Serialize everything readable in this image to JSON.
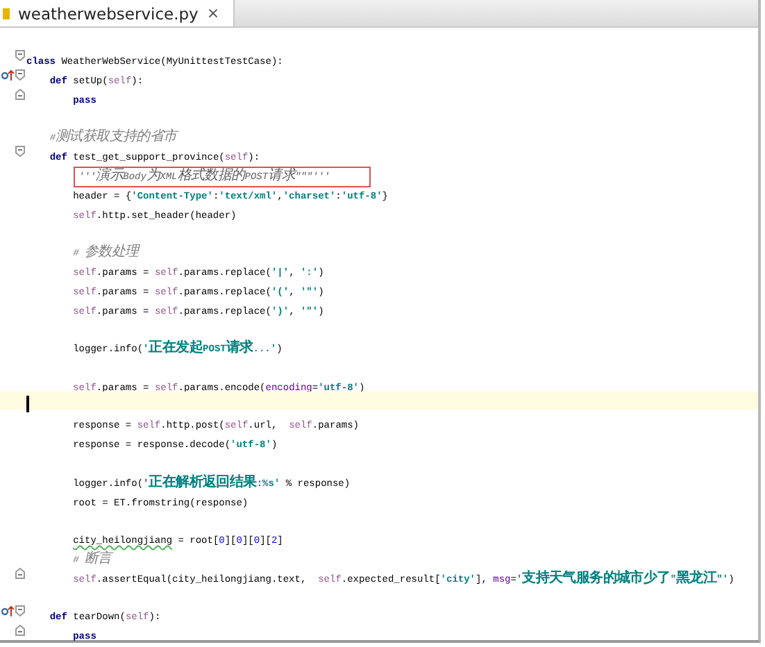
{
  "tabs": [
    {
      "label": "weatherwebservice.py",
      "close": "×",
      "selected": true
    }
  ],
  "lines": [
    {
      "current": false,
      "fold_start": true,
      "fold_end": false,
      "override": false,
      "tokens": [
        {
          "kind": "keyword",
          "text": "class"
        },
        {
          "kind": "plain",
          "text": " WeatherWebService(MyUnittestTestCase):"
        }
      ]
    },
    {
      "current": false,
      "fold_start": true,
      "fold_end": false,
      "override": true,
      "tokens": [
        {
          "kind": "keyword",
          "text": "    def"
        },
        {
          "kind": "plain",
          "text": " setUp("
        },
        {
          "kind": "self",
          "text": "self"
        },
        {
          "kind": "plain",
          "text": "):"
        }
      ]
    },
    {
      "current": false,
      "fold_start": false,
      "fold_end": true,
      "override": false,
      "tokens": [
        {
          "kind": "keyword",
          "text": "        pass"
        }
      ]
    },
    {
      "current": false,
      "fold_start": false,
      "fold_end": false,
      "override": false
    },
    {
      "current": false,
      "fold_start": false,
      "fold_end": false,
      "override": false,
      "tokens": [
        {
          "kind": "comment",
          "text": "    #测试获取支持的省市"
        }
      ]
    },
    {
      "current": false,
      "fold_start": true,
      "fold_end": false,
      "override": false,
      "tokens": [
        {
          "kind": "keyword",
          "text": "    def"
        },
        {
          "kind": "plain",
          "text": " test_get_support_province("
        },
        {
          "kind": "self",
          "text": "self"
        },
        {
          "kind": "plain",
          "text": "):"
        }
      ]
    },
    {
      "current": false,
      "fold_start": false,
      "fold_end": false,
      "override": false,
      "tokens": [
        {
          "kind": "docstring",
          "boxed": true,
          "text": "        '''演示Body为XML格式数据的POST请求\"\"\"'''"
        }
      ]
    },
    {
      "current": false,
      "fold_start": false,
      "fold_end": false,
      "override": false,
      "tokens": [
        {
          "kind": "plain",
          "text": "        header = {"
        },
        {
          "kind": "string",
          "text": "'Content-Type'"
        },
        {
          "kind": "plain",
          "text": ":"
        },
        {
          "kind": "string",
          "text": "'text/xml'"
        },
        {
          "kind": "plain",
          "text": ","
        },
        {
          "kind": "string",
          "text": "'charset'"
        },
        {
          "kind": "plain",
          "text": ":"
        },
        {
          "kind": "string",
          "text": "'utf-8'"
        },
        {
          "kind": "plain",
          "text": "}"
        }
      ]
    },
    {
      "current": false,
      "fold_start": false,
      "fold_end": false,
      "override": false,
      "tokens": [
        {
          "kind": "self",
          "text": "        self"
        },
        {
          "kind": "plain",
          "text": ".http.set_header(header)"
        }
      ]
    },
    {
      "current": false,
      "fold_start": false,
      "fold_end": false,
      "override": false
    },
    {
      "current": false,
      "fold_start": false,
      "fold_end": false,
      "override": false,
      "tokens": [
        {
          "kind": "comment",
          "text": "        # 参数处理"
        }
      ]
    },
    {
      "current": false,
      "fold_start": false,
      "fold_end": false,
      "override": false,
      "tokens": [
        {
          "kind": "self",
          "text": "        self"
        },
        {
          "kind": "plain",
          "text": ".params = "
        },
        {
          "kind": "self",
          "text": "self"
        },
        {
          "kind": "plain",
          "text": ".params.replace("
        },
        {
          "kind": "string",
          "text": "'|'"
        },
        {
          "kind": "plain",
          "text": ", "
        },
        {
          "kind": "string",
          "text": "':'"
        },
        {
          "kind": "plain",
          "text": ")"
        }
      ]
    },
    {
      "current": false,
      "fold_start": false,
      "fold_end": false,
      "override": false,
      "tokens": [
        {
          "kind": "self",
          "text": "        self"
        },
        {
          "kind": "plain",
          "text": ".params = "
        },
        {
          "kind": "self",
          "text": "self"
        },
        {
          "kind": "plain",
          "text": ".params.replace("
        },
        {
          "kind": "string",
          "text": "'('"
        },
        {
          "kind": "plain",
          "text": ", "
        },
        {
          "kind": "string",
          "text": "'\"'"
        },
        {
          "kind": "plain",
          "text": ")"
        }
      ]
    },
    {
      "current": false,
      "fold_start": false,
      "fold_end": false,
      "override": false,
      "tokens": [
        {
          "kind": "self",
          "text": "        self"
        },
        {
          "kind": "plain",
          "text": ".params = "
        },
        {
          "kind": "self",
          "text": "self"
        },
        {
          "kind": "plain",
          "text": ".params.replace("
        },
        {
          "kind": "string",
          "text": "')'"
        },
        {
          "kind": "plain",
          "text": ", "
        },
        {
          "kind": "string",
          "text": "'\"'"
        },
        {
          "kind": "plain",
          "text": ")"
        }
      ]
    },
    {
      "current": false,
      "fold_start": false,
      "fold_end": false,
      "override": false
    },
    {
      "current": false,
      "fold_start": false,
      "fold_end": false,
      "override": false,
      "tokens": [
        {
          "kind": "plain",
          "text": "        logger.info("
        },
        {
          "kind": "string",
          "text": "'正在发起POST请求...'"
        },
        {
          "kind": "plain",
          "text": ")"
        }
      ]
    },
    {
      "current": false,
      "fold_start": false,
      "fold_end": false,
      "override": false
    },
    {
      "current": false,
      "fold_start": false,
      "fold_end": false,
      "override": false,
      "tokens": [
        {
          "kind": "self",
          "text": "        self"
        },
        {
          "kind": "plain",
          "text": ".params = "
        },
        {
          "kind": "self",
          "text": "self"
        },
        {
          "kind": "plain",
          "text": ".params.encode("
        },
        {
          "kind": "kwarg",
          "text": "encoding"
        },
        {
          "kind": "plain",
          "text": "="
        },
        {
          "kind": "string",
          "text": "'utf-8'"
        },
        {
          "kind": "plain",
          "text": ")"
        }
      ]
    },
    {
      "current": true,
      "fold_start": false,
      "fold_end": false,
      "override": false
    },
    {
      "current": false,
      "fold_start": false,
      "fold_end": false,
      "override": false,
      "tokens": [
        {
          "kind": "plain",
          "text": "        response = "
        },
        {
          "kind": "self",
          "text": "self"
        },
        {
          "kind": "plain",
          "text": ".http.post("
        },
        {
          "kind": "self",
          "text": "self"
        },
        {
          "kind": "plain",
          "text": ".url,  "
        },
        {
          "kind": "self",
          "text": "self"
        },
        {
          "kind": "plain",
          "text": ".params)"
        }
      ]
    },
    {
      "current": false,
      "fold_start": false,
      "fold_end": false,
      "override": false,
      "tokens": [
        {
          "kind": "plain",
          "text": "        response = response.decode("
        },
        {
          "kind": "string",
          "text": "'utf-8'"
        },
        {
          "kind": "plain",
          "text": ")"
        }
      ]
    },
    {
      "current": false,
      "fold_start": false,
      "fold_end": false,
      "override": false
    },
    {
      "current": false,
      "fold_start": false,
      "fold_end": false,
      "override": false,
      "tokens": [
        {
          "kind": "plain",
          "text": "        logger.info("
        },
        {
          "kind": "string",
          "text": "'正在解析返回结果:%s'"
        },
        {
          "kind": "plain",
          "text": " % response)"
        }
      ]
    },
    {
      "current": false,
      "fold_start": false,
      "fold_end": false,
      "override": false,
      "tokens": [
        {
          "kind": "plain",
          "text": "        root = ET.fromstring(response)"
        }
      ]
    },
    {
      "current": false,
      "fold_start": false,
      "fold_end": false,
      "override": false
    },
    {
      "current": false,
      "fold_start": false,
      "fold_end": false,
      "override": false,
      "tokens": [
        {
          "kind": "typo",
          "text": "        city_heilongjiang"
        },
        {
          "kind": "plain",
          "text": " = root["
        },
        {
          "kind": "number",
          "text": "0"
        },
        {
          "kind": "plain",
          "text": "]["
        },
        {
          "kind": "number",
          "text": "0"
        },
        {
          "kind": "plain",
          "text": "]["
        },
        {
          "kind": "number",
          "text": "0"
        },
        {
          "kind": "plain",
          "text": "]["
        },
        {
          "kind": "number",
          "text": "2"
        },
        {
          "kind": "plain",
          "text": "]"
        }
      ]
    },
    {
      "current": false,
      "fold_start": false,
      "fold_end": false,
      "override": false,
      "tokens": [
        {
          "kind": "comment",
          "text": "        # 断言"
        }
      ]
    },
    {
      "current": false,
      "fold_start": false,
      "fold_end": true,
      "override": false,
      "tokens": [
        {
          "kind": "self",
          "text": "        self"
        },
        {
          "kind": "plain",
          "text": ".assertEqual(city_heilongjiang.text,  "
        },
        {
          "kind": "self",
          "text": "self"
        },
        {
          "kind": "plain",
          "text": ".expected_result["
        },
        {
          "kind": "string",
          "text": "'city'"
        },
        {
          "kind": "plain",
          "text": "], "
        },
        {
          "kind": "kwarg",
          "text": "msg"
        },
        {
          "kind": "plain",
          "text": "="
        },
        {
          "kind": "string",
          "text": "'支持天气服务的城市少了\"黑龙江\"'"
        },
        {
          "kind": "plain",
          "text": ")"
        }
      ]
    },
    {
      "current": false,
      "fold_start": false,
      "fold_end": false,
      "override": false
    },
    {
      "current": false,
      "fold_start": true,
      "fold_end": false,
      "override": true,
      "tokens": [
        {
          "kind": "keyword",
          "text": "    def"
        },
        {
          "kind": "plain",
          "text": " tearDown("
        },
        {
          "kind": "self",
          "text": "self"
        },
        {
          "kind": "plain",
          "text": "):"
        }
      ]
    },
    {
      "current": false,
      "fold_start": false,
      "fold_end": true,
      "override": false,
      "tokens": [
        {
          "kind": "keyword",
          "text": "        pass"
        }
      ]
    }
  ]
}
